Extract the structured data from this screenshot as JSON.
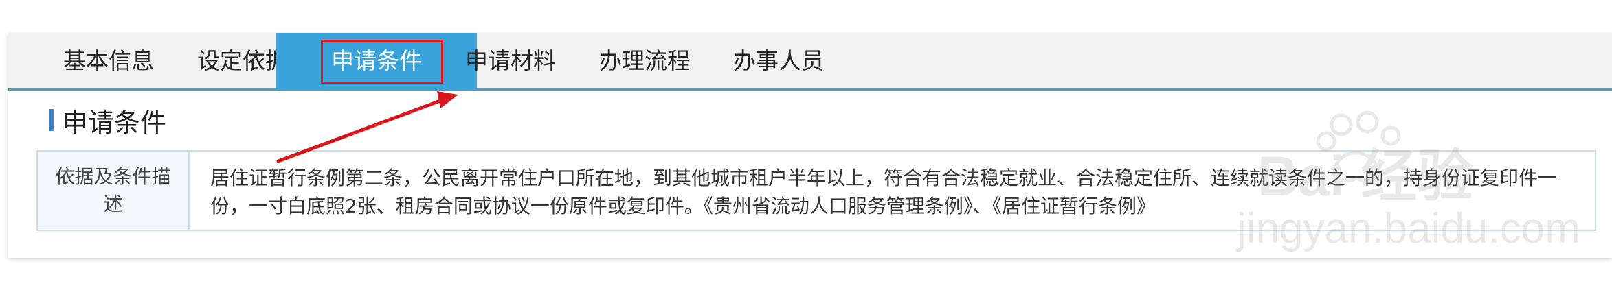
{
  "tabs": [
    {
      "label": "基本信息",
      "active": false
    },
    {
      "label": "设定依据",
      "active": false
    },
    {
      "label": "申请条件",
      "active": true
    },
    {
      "label": "申请材料",
      "active": false
    },
    {
      "label": "办理流程",
      "active": false
    },
    {
      "label": "办事人员",
      "active": false
    }
  ],
  "section": {
    "title": "申请条件"
  },
  "table": {
    "label": "依据及条件描述",
    "value": "居住证暂行条例第二条，公民离开常住户口所在地，到其他城市租户半年以上，符合有合法稳定就业、合法稳定住所、连续就读条件之一的，持身份证复印件一份，一寸白底照2张、租房合同或协议一份原件或复印件。《贵州省流动人口服务管理条例》、《居住证暂行条例》"
  },
  "watermark": {
    "main": "Bai 经验",
    "sub": "jingyan.baidu.com"
  },
  "colors": {
    "tab_active_bg": "#3aa3dc",
    "annotation_red": "#d9161b",
    "title_accent": "#3a7fd0"
  },
  "icons": {
    "annotation": "red-arrow-icon",
    "watermark_logo": "baidu-paw-icon"
  }
}
